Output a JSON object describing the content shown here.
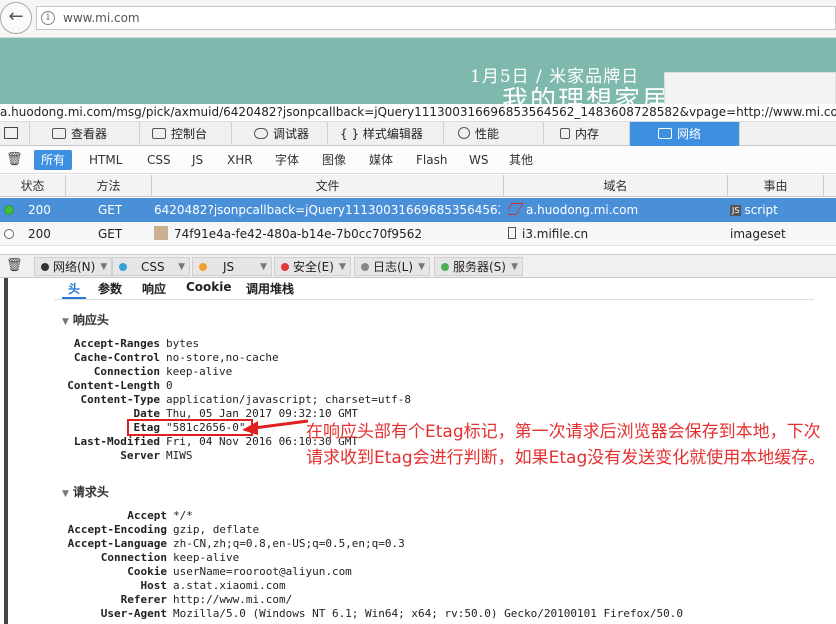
{
  "browser": {
    "url": "www.mi.com",
    "back_glyph": "←",
    "info_glyph": "i"
  },
  "banner": {
    "line1": "1月5日 / 米家品牌日",
    "line2": "我的理想家居"
  },
  "request_url": "a.huodong.mi.com/msg/pick/axmuid/6420482?jsonpcallback=jQuery111300316696853564562_1483608728582&vpage=http://www.mi.com/&_=1",
  "devtools": {
    "tabs": [
      {
        "label": "查看器"
      },
      {
        "label": "控制台"
      },
      {
        "label": "调试器"
      },
      {
        "label": "样式编辑器",
        "prefix": "{ }"
      },
      {
        "label": "性能"
      },
      {
        "label": "内存"
      },
      {
        "label": "网络"
      }
    ],
    "filters": [
      "所有",
      "HTML",
      "CSS",
      "JS",
      "XHR",
      "字体",
      "图像",
      "媒体",
      "Flash",
      "WS",
      "其他"
    ],
    "columns": [
      "状态",
      "方法",
      "文件",
      "域名",
      "事由"
    ],
    "rows": [
      {
        "status": "200",
        "method": "GET",
        "file": "6420482?jsonpcallback=jQuery111300316696853564562_...",
        "domain": "a.huodong.mi.com",
        "cause_badge": "JS",
        "cause": "script"
      },
      {
        "status": "200",
        "method": "GET",
        "file": "74f91e4a-fe42-480a-b14e-7b0cc70f9562",
        "domain": "i3.mifile.cn",
        "cause": "imageset"
      }
    ],
    "console_filters": [
      {
        "label": "网络(N)",
        "color": "#333333"
      },
      {
        "label": "CSS",
        "color": "#3aa0d8"
      },
      {
        "label": "JS",
        "color": "#f0a030"
      },
      {
        "label": "安全(E)",
        "color": "#e03a3a"
      },
      {
        "label": "日志(L)",
        "color": "#888888"
      },
      {
        "label": "服务器(S)",
        "color": "#4caf50"
      }
    ]
  },
  "detail": {
    "tabs": [
      "头",
      "参数",
      "响应",
      "Cookie",
      "调用堆栈"
    ],
    "response_header_title": "响应头",
    "response_headers": [
      {
        "k": "Accept-Ranges",
        "v": "bytes"
      },
      {
        "k": "Cache-Control",
        "v": "no-store,no-cache"
      },
      {
        "k": "Connection",
        "v": "keep-alive"
      },
      {
        "k": "Content-Length",
        "v": "0"
      },
      {
        "k": "Content-Type",
        "v": "application/javascript; charset=utf-8"
      },
      {
        "k": "Date",
        "v": "Thu, 05 Jan 2017 09:32:10 GMT"
      },
      {
        "k": "Etag",
        "v": "\"581c2656-0\""
      },
      {
        "k": "Last-Modified",
        "v": "Fri, 04 Nov 2016 06:10:30 GMT"
      },
      {
        "k": "Server",
        "v": "MIWS"
      }
    ],
    "request_header_title": "请求头",
    "request_headers": [
      {
        "k": "Accept",
        "v": "*/*"
      },
      {
        "k": "Accept-Encoding",
        "v": "gzip, deflate"
      },
      {
        "k": "Accept-Language",
        "v": "zh-CN,zh;q=0.8,en-US;q=0.5,en;q=0.3"
      },
      {
        "k": "Connection",
        "v": "keep-alive"
      },
      {
        "k": "Cookie",
        "v": "userName=rooroot@aliyun.com"
      },
      {
        "k": "Host",
        "v": "a.stat.xiaomi.com"
      },
      {
        "k": "Referer",
        "v": "http://www.mi.com/"
      },
      {
        "k": "User-Agent",
        "v": "Mozilla/5.0 (Windows NT 6.1; Win64; x64; rv:50.0) Gecko/20100101 Firefox/50.0"
      }
    ]
  },
  "annotation": "在响应头部有个Etag标记，第一次请求后浏览器会保存到本地，下次请求收到Etag会进行判断，如果Etag没有发送变化就使用本地缓存。",
  "colors": {
    "accent": "#3d8fe0",
    "annotation": "#e53030",
    "banner": "#7fb9ae"
  }
}
